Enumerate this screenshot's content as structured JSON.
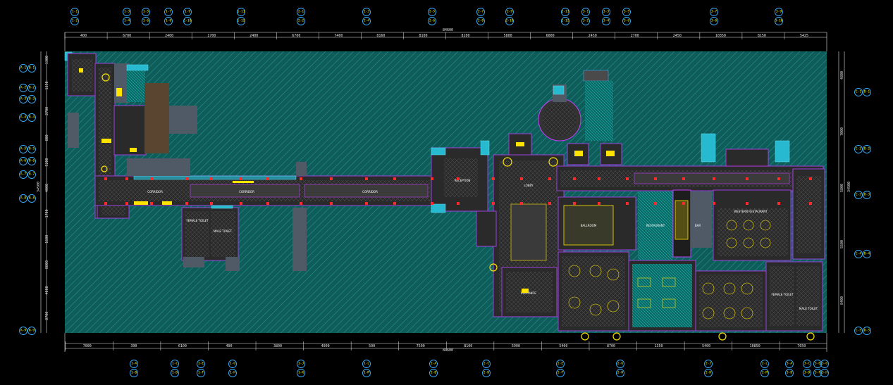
{
  "drawing": {
    "colors": {
      "background": "#000000",
      "hatch_fill": "#0f5d5a",
      "hatch_line": "#2a9a92",
      "grid_bubble": "#3ab0ff",
      "grid_text": "#ffff00",
      "wall_magenta": "#c83cff",
      "wall_red": "#ff3030",
      "furniture_yellow": "#ffe400",
      "dim_line": "#e6e6e6"
    },
    "top_dimensions": [
      "400",
      "6700",
      "2400",
      "1700",
      "2400",
      "6700",
      "7400",
      "8160",
      "8100",
      "8100",
      "5800",
      "6000",
      "2450",
      "2700",
      "2450",
      "10350",
      "8150",
      "5425"
    ],
    "top_overall": "84600",
    "bottom_dimensions": [
      "7000",
      "390",
      "6100",
      "400",
      "3800",
      "4000",
      "500",
      "7500",
      "8100",
      "5900",
      "5400",
      "8700",
      "1350",
      "5400",
      "10850",
      "7650"
    ],
    "bottom_overall": "84600",
    "left_dimensions": [
      "1300",
      "1350",
      "2700",
      "800",
      "5200",
      "4000",
      "1700",
      "1600",
      "8800",
      "4000",
      "8700"
    ],
    "left_overall": "34500",
    "right_dimensions": [
      "4800",
      "7000",
      "5800",
      "5500",
      "8400"
    ],
    "right_overall": "34500",
    "top_grid_labels": [
      [
        "1-1",
        "1-2"
      ],
      [
        "1-3",
        "1-4"
      ],
      [
        "1-5",
        "1-6"
      ],
      [
        "1-7",
        "1-8"
      ],
      [
        "1-9",
        "1-10"
      ],
      [
        "1-11",
        "1-12"
      ],
      [
        "2-1",
        "2-2"
      ],
      [
        "2-3",
        "2-4"
      ],
      [
        "2-5",
        "2-6"
      ],
      [
        "2-7",
        "2-8"
      ],
      [
        "2-9",
        "2-10"
      ],
      [
        "2-11",
        "2-12"
      ],
      [
        "3-1",
        "3-2"
      ],
      [
        "3-3",
        "3-4"
      ],
      [
        "3-5",
        "3-6"
      ],
      [
        "3-7",
        "3-8"
      ],
      [
        "3-9",
        "3-10"
      ]
    ],
    "bottom_grid_labels": [
      [
        "1-A",
        "1-B"
      ],
      [
        "1-C",
        "1-D"
      ],
      [
        "1-E",
        "1-F"
      ],
      [
        "1-G",
        "1-H"
      ],
      [
        "1-J",
        "1-K"
      ],
      [
        "1-L",
        "1-M"
      ],
      [
        "2-A",
        "2-B"
      ],
      [
        "2-C",
        "2-D"
      ],
      [
        "2-E",
        "2-F"
      ],
      [
        "2-G",
        "2-H"
      ],
      [
        "2-J",
        "2-K"
      ],
      [
        "2-L",
        "2-M"
      ],
      [
        "3-A",
        "3-B"
      ],
      [
        "3-C",
        "3-D"
      ],
      [
        "3-E",
        "3-F"
      ],
      [
        "3-G",
        "3-H"
      ]
    ],
    "left_grid_labels": [
      [
        "A-1",
        "B-1"
      ],
      [
        "A-2",
        "B-2"
      ],
      [
        "A-3",
        "B-3"
      ],
      [
        "A-4",
        "B-4"
      ],
      [
        "A-5",
        "B-5"
      ],
      [
        "A-6",
        "B-6"
      ],
      [
        "A-7",
        "B-7"
      ],
      [
        "A-8",
        "B-8"
      ],
      [
        "A-9",
        "B-9"
      ]
    ],
    "right_grid_labels": [
      [
        "C-1",
        "D-1"
      ],
      [
        "C-2",
        "D-2"
      ],
      [
        "C-3",
        "D-3"
      ],
      [
        "C-4",
        "D-4"
      ],
      [
        "C-5",
        "D-5"
      ]
    ],
    "room_labels": [
      "CORRIDOR",
      "CORRIDOR",
      "CORRIDOR",
      "FEMALE TOILET",
      "MALE TOILET",
      "RECEPTION",
      "BALLROOM",
      "RESTAURANT",
      "BAR",
      "WESTERN RESTAURANT",
      "ENTRANCE",
      "LOBBY",
      "FEMALE TOILET",
      "MALE TOILET"
    ]
  }
}
